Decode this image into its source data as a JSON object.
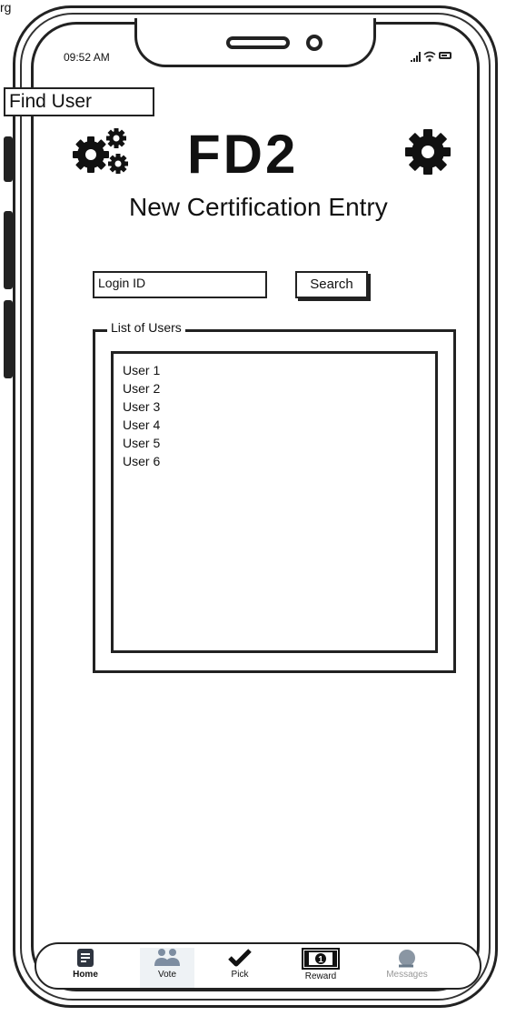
{
  "corner_text": "rg",
  "status_bar": {
    "time": "09:52 AM"
  },
  "header": {
    "find_user_label": "Find User",
    "title": "FD2",
    "subtitle": "New Certification Entry"
  },
  "search": {
    "login_value": "Login ID",
    "search_label": "Search"
  },
  "users_panel": {
    "legend": "List of Users",
    "users": [
      "User 1",
      "User 2",
      "User 3",
      "User 4",
      "User 5",
      "User 6"
    ]
  },
  "tabbar": {
    "tabs": [
      {
        "label": "Home",
        "icon": "home-icon"
      },
      {
        "label": "Vote",
        "icon": "people-icon"
      },
      {
        "label": "Pick",
        "icon": "checkmark-icon"
      },
      {
        "label": "Reward",
        "icon": "banknote-icon"
      },
      {
        "label": "Messages",
        "icon": "chat-icon"
      }
    ]
  },
  "colors": {
    "ink": "#222222",
    "muted_icon": "#7d8da1",
    "dim_text": "#999999"
  }
}
